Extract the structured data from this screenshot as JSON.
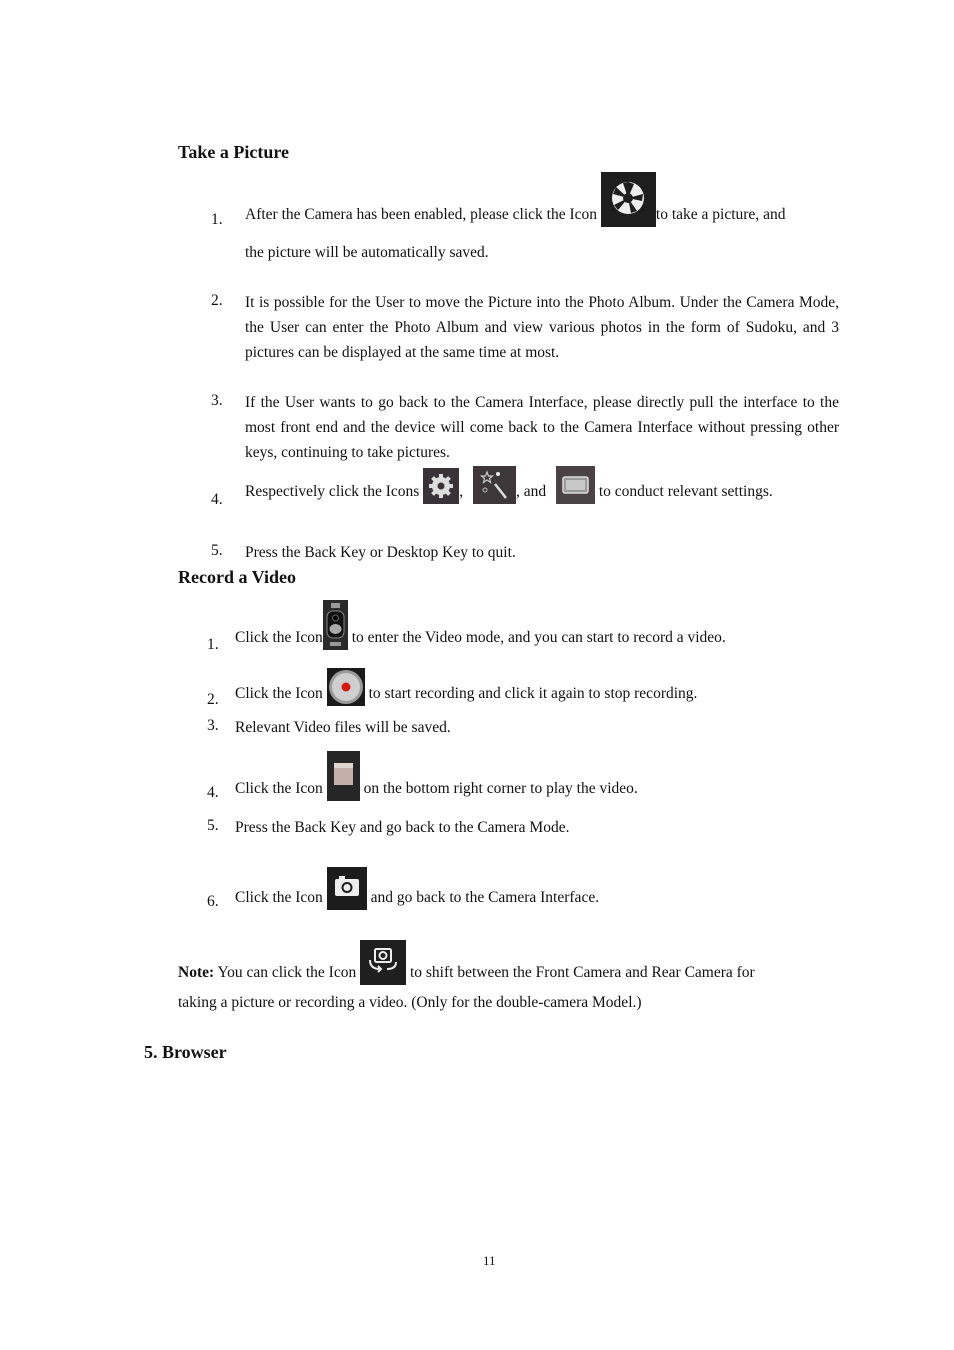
{
  "sections": {
    "take_picture": {
      "title": "Take a Picture",
      "items": [
        {
          "num": "1.",
          "before": "After the Camera has been enabled, please click the Icon ",
          "icon": "shutter-icon",
          "after": "to take a picture, and",
          "line2": "the picture will be automatically saved."
        },
        {
          "num": "2.",
          "text": "It is possible for the User to move the Picture into the Photo Album. Under the Camera Mode, the User can enter the Photo Album and view various photos in the form of Sudoku, and 3 pictures can be displayed at the same time at most."
        },
        {
          "num": "3.",
          "text": "If the User wants to go back to the Camera Interface, please directly pull the interface to the most front end and the device will come back to the Camera Interface without pressing other keys, continuing to take pictures."
        },
        {
          "num": "4.",
          "before": "Respectively click the Icons ",
          "sep1": ",",
          "sep2": ", and",
          "after": " to conduct relevant settings.",
          "icons": [
            "settings-gear-icon",
            "magic-wand-effects-icon",
            "screen-mode-icon"
          ]
        },
        {
          "num": "5.",
          "text": "Press the Back Key or Desktop Key to quit."
        }
      ]
    },
    "record_video": {
      "title": "Record a Video",
      "items": [
        {
          "num": "1.",
          "before": "Click the Icon",
          "after": "  to enter the Video mode, and you can start to record a video.",
          "icon": "camera-video-switch-icon"
        },
        {
          "num": "2.",
          "before": "Click the Icon ",
          "after": " to start recording and click it again to stop recording.",
          "icon": "record-button-icon"
        },
        {
          "num": "3.",
          "text": "Relevant Video files will be saved."
        },
        {
          "num": "4.",
          "before": "Click the Icon ",
          "after": " on the bottom right corner to play the video.",
          "icon": "video-thumbnail-icon"
        },
        {
          "num": "5.",
          "text": "Press the Back Key and go back to the Camera Mode."
        },
        {
          "num": "6.",
          "before": "Click the Icon ",
          "after": " and go back to the Camera Interface.",
          "icon": "camera-icon"
        }
      ]
    },
    "note": {
      "label": "Note:",
      "before": " You can click the Icon ",
      "after": " to shift between the Front Camera and Rear Camera for",
      "line2": "taking a picture or recording a video. (Only for the double-camera Model.)",
      "icon": "switch-camera-icon"
    },
    "browser": {
      "title": "5. Browser"
    }
  },
  "footer": {
    "page_number": "11"
  }
}
